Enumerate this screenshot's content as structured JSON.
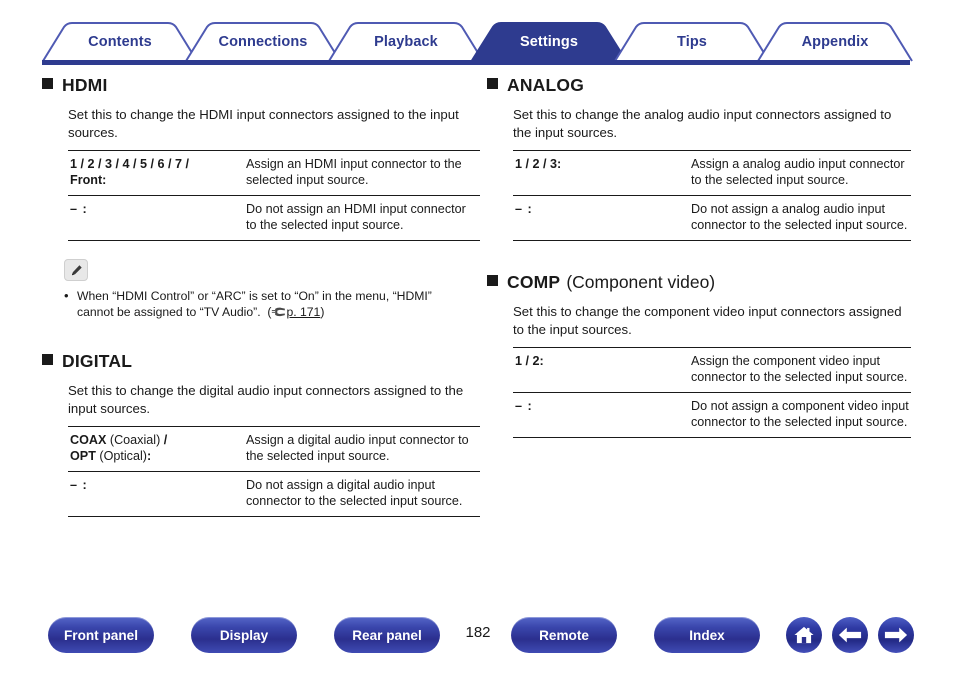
{
  "tabs": [
    {
      "label": "Contents",
      "active": false
    },
    {
      "label": "Connections",
      "active": false
    },
    {
      "label": "Playback",
      "active": false
    },
    {
      "label": "Settings",
      "active": true
    },
    {
      "label": "Tips",
      "active": false
    },
    {
      "label": "Appendix",
      "active": false
    }
  ],
  "colors": {
    "brand_blue": "#2e3b8f",
    "tab_active_fill": "#2e3b8f",
    "tab_active_text": "#ffffff",
    "tab_inactive_text": "#2e3b8f",
    "body_text": "#1a1a1a",
    "button_blue": "#2b2f8e"
  },
  "sections": {
    "hdmi": {
      "heading_main": "HDMI",
      "heading_sub": "",
      "lead": "Set this to change the HDMI input connectors assigned to the input sources.",
      "rows": [
        {
          "term_bold_1": "1 / 2 / 3 / 4 / 5 / 6 / 7 /",
          "term_bold_2": "Front:",
          "desc": "Assign an HDMI input connector to the selected input source."
        },
        {
          "term_bold_1": "– :",
          "term_bold_2": "",
          "desc": "Do not assign an HDMI input connector to the selected input source."
        }
      ],
      "note": {
        "icon": "pencil-icon",
        "bullet": "•",
        "text": "When “HDMI Control” or “ARC” is set to “On” in the menu, “HDMI” cannot be assigned to “TV Audio”.",
        "page_ref_icon": "pointing-hand-icon",
        "page_ref_open": "(",
        "page_ref": "p. 171",
        "page_ref_close": ")"
      }
    },
    "digital": {
      "heading_main": "DIGITAL",
      "heading_sub": "",
      "lead": "Set this to change the digital audio input connectors assigned to the input sources.",
      "rows": [
        {
          "term_bold_1": "COAX",
          "term_plain_1": " (Coaxial) ",
          "term_bold_1b": "/",
          "term_bold_2": "OPT",
          "term_plain_2": " (Optical)",
          "term_bold_2b": ":",
          "desc": "Assign a digital audio input connector to the selected input source."
        },
        {
          "term_bold_1": "– :",
          "term_bold_2": "",
          "desc": "Do not assign a digital audio input connector to the selected input source."
        }
      ]
    },
    "analog": {
      "heading_main": "ANALOG",
      "heading_sub": "",
      "lead": "Set this to change the analog audio input connectors assigned to the input sources.",
      "rows": [
        {
          "term_bold_1": "1 / 2 / 3:",
          "term_bold_2": "",
          "desc": "Assign a analog audio input connector to the selected input source."
        },
        {
          "term_bold_1": "– :",
          "term_bold_2": "",
          "desc": "Do not assign a analog audio input connector to the selected input source."
        }
      ]
    },
    "comp": {
      "heading_main": "COMP",
      "heading_sub": "(Component video)",
      "lead": "Set this to change the component video input connectors assigned to the input sources.",
      "rows": [
        {
          "term_bold_1": "1 / 2:",
          "term_bold_2": "",
          "desc": "Assign the component video input connector to the selected input source."
        },
        {
          "term_bold_1": "– :",
          "term_bold_2": "",
          "desc": "Do not assign a component video input connector to the selected input source."
        }
      ]
    }
  },
  "footer": {
    "buttons": [
      {
        "label": "Front panel"
      },
      {
        "label": "Display"
      },
      {
        "label": "Rear panel"
      },
      {
        "label": "Remote"
      },
      {
        "label": "Index"
      }
    ],
    "page_number": "182",
    "icons": [
      {
        "name": "home-icon"
      },
      {
        "name": "arrow-left-icon"
      },
      {
        "name": "arrow-right-icon"
      }
    ]
  }
}
